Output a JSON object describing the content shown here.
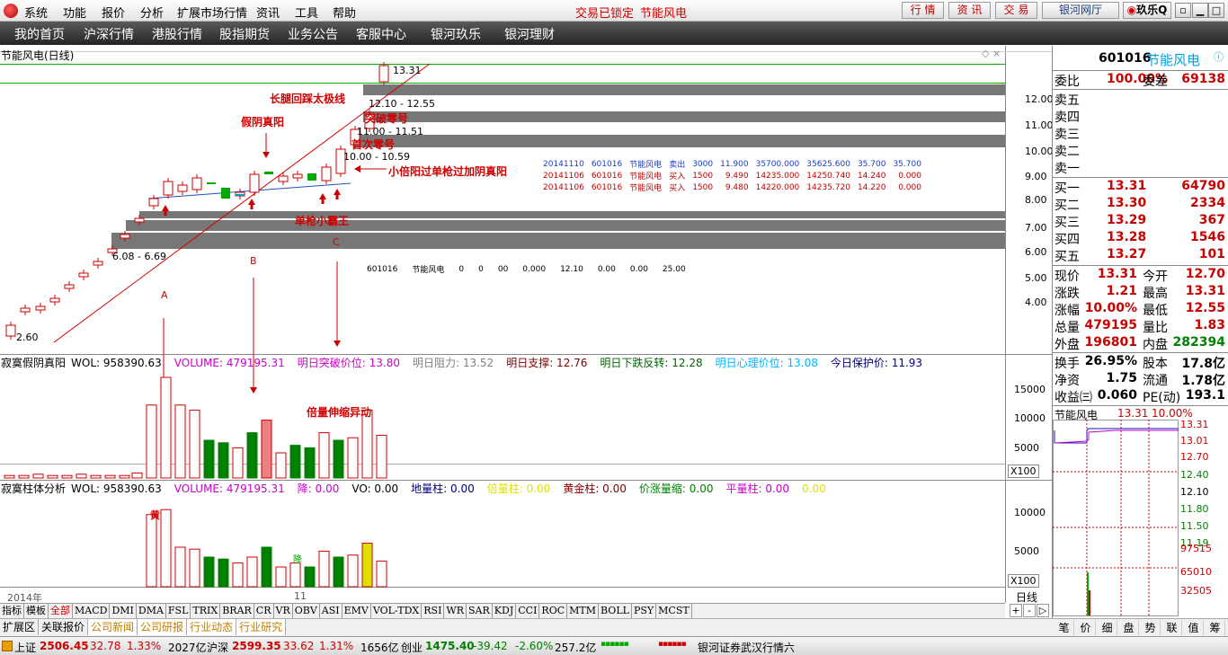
{
  "menu": {
    "items": [
      "系统",
      "功能",
      "报价",
      "分析",
      "扩展市场行情",
      "资讯",
      "工具",
      "帮助"
    ],
    "status_left": "交易已锁定",
    "status_stock": "节能风电",
    "btn_quote": "行 情",
    "btn_info": "资 讯",
    "btn_trade": "交 易",
    "btn_hall": "银河网厅",
    "btn_fun": "玖乐Q"
  },
  "nav": {
    "items": [
      "我的首页",
      "沪深行情",
      "港股行情",
      "股指期货",
      "业务公告",
      "客服中心",
      "银河玖乐",
      "银河理财"
    ]
  },
  "chart": {
    "title": "节能风电(日线)",
    "price_labels": {
      "high": "13.31",
      "low": "2.60",
      "r1": "12.10 - 12.55",
      "r2": "11.00 - 11.51",
      "r3": "10.00 - 10.59",
      "r4": "6.08 - 6.69"
    },
    "annotations": {
      "a1": "长腿回踩太极线",
      "a2": "假阴真阳",
      "a3": "突破零号",
      "a4": "首次零号",
      "a5": "小倍阳过单枪过加阴真阳",
      "a6": "单枪小霸王",
      "a7": "倍量伸缩异动",
      "lA": "A",
      "lB": "B",
      "lC": "C"
    },
    "yaxis": [
      "12.00",
      "11.00",
      "10.00",
      "9.00",
      "8.00",
      "7.00",
      "6.00",
      "5.00",
      "4.00"
    ],
    "deals": [
      [
        "20141110",
        "601016",
        "节能风电",
        "卖出",
        "3000",
        "11.900",
        "35700.000",
        "35625.600",
        "35.700",
        "35.700"
      ],
      [
        "20141106",
        "601016",
        "节能风电",
        "买入",
        "1500",
        "9.490",
        "14235.000",
        "14250.740",
        "14.240",
        "0.000"
      ],
      [
        "20141106",
        "601016",
        "节能风电",
        "买入",
        "1500",
        "9.480",
        "14220.000",
        "14235.720",
        "14.220",
        "0.000"
      ]
    ],
    "pos_row": [
      "601016",
      "节能风电",
      "0",
      "0",
      "00",
      "0.000",
      "12.10",
      "0.00",
      "0.00",
      "25.00"
    ]
  },
  "vol": {
    "name": "寂寞假阴真阳",
    "items": [
      {
        "t": "WOL: 958390.63",
        "c": "#000"
      },
      {
        "t": "VOLUME: 479195.31",
        "c": "#c800c8"
      },
      {
        "t": "明日突破价位: 13.80",
        "c": "#c800c8"
      },
      {
        "t": "明日阻力: 13.52",
        "c": "#808080"
      },
      {
        "t": "明日支撑: 12.76",
        "c": "#800000"
      },
      {
        "t": "明日下跌反转: 12.28",
        "c": "#006400"
      },
      {
        "t": "明日心理价位: 13.08",
        "c": "#00b4ff"
      },
      {
        "t": "今日保护价: 11.93",
        "c": "#000080"
      }
    ],
    "yaxis": [
      "15000",
      "10000",
      "5000"
    ],
    "unit": "X100"
  },
  "ind": {
    "name": "寂寞柱体分析",
    "items": [
      {
        "t": "WOL: 958390.63",
        "c": "#000"
      },
      {
        "t": "VOLUME: 479195.31",
        "c": "#c800c8"
      },
      {
        "t": "降: 0.00",
        "c": "#c800c8"
      },
      {
        "t": "VO: 0.00",
        "c": "#000"
      },
      {
        "t": "地量柱: 0.00",
        "c": "#000080"
      },
      {
        "t": "倍量柱: 0.00",
        "c": "#e0e000"
      },
      {
        "t": "黄金柱: 0.00",
        "c": "#800000"
      },
      {
        "t": "价涨量缩: 0.00",
        "c": "#008000"
      },
      {
        "t": "平量柱: 0.00",
        "c": "#c800c8"
      },
      {
        "t": "0.00",
        "c": "#e0e000"
      }
    ],
    "yaxis": [
      "10000",
      "5000"
    ],
    "unit": "X100",
    "year": "2014年",
    "month": "11",
    "label_huang": "黄",
    "label_jiang": "降"
  },
  "tabs": [
    "指标",
    "模板",
    "全部",
    "MACD",
    "DMI",
    "DMA",
    "FSL",
    "TRIX",
    "BRAR",
    "CR",
    "VR",
    "OBV",
    "ASI",
    "EMV",
    "VOL-TDX",
    "RSI",
    "WR",
    "SAR",
    "KDJ",
    "CCI",
    "ROC",
    "MTM",
    "BOLL",
    "PSY",
    "MCST"
  ],
  "ftabs": [
    "扩展区",
    "关联报价",
    "公司新闻",
    "公司研报",
    "行业动态",
    "行业研究"
  ],
  "quote": {
    "code": "601016",
    "name": "节能风电",
    "wb_label": "委比",
    "wb": "100.00%",
    "wc_label": "委差",
    "wc": "69138",
    "sells": [
      "卖五",
      "卖四",
      "卖三",
      "卖二",
      "卖一"
    ],
    "buys": [
      [
        "买一",
        "13.31",
        "64790"
      ],
      [
        "买二",
        "13.30",
        "2334"
      ],
      [
        "买三",
        "13.29",
        "367"
      ],
      [
        "买四",
        "13.28",
        "1546"
      ],
      [
        "买五",
        "13.27",
        "101"
      ]
    ],
    "stats": [
      [
        "现价",
        "13.31",
        "今开",
        "12.70"
      ],
      [
        "涨跌",
        "1.21",
        "最高",
        "13.31"
      ],
      [
        "涨幅",
        "10.00%",
        "最低",
        "12.55"
      ],
      [
        "总量",
        "479195",
        "量比",
        "1.83"
      ],
      [
        "外盘",
        "196801",
        "内盘",
        "282394"
      ]
    ],
    "stats2": [
      [
        "换手",
        "26.95%",
        "股本",
        "17.8亿"
      ],
      [
        "净资",
        "1.75",
        "流通",
        "1.78亿"
      ],
      [
        "收益㈢",
        "0.060",
        "PE(动)",
        "193.1"
      ]
    ],
    "mini_name": "节能风电",
    "mini_price": "13.31",
    "mini_pct": "10.00%",
    "mini_y": [
      "13.31",
      "13.01",
      "12.70",
      "12.40",
      "12.10",
      "11.80",
      "11.50",
      "11.19"
    ],
    "mini_v": [
      "97515",
      "65010",
      "32505"
    ],
    "mini_unit": "日线",
    "tabs": [
      "笔",
      "价",
      "细",
      "盘",
      "势",
      "联",
      "值",
      "筹"
    ]
  },
  "status": {
    "sh": "上证",
    "sh_v": "2506.45",
    "sh_c": "32.78",
    "sh_p": "1.33%",
    "sh_a": "2027亿",
    "hs": "沪深",
    "hs_v": "2599.35",
    "hs_c": "33.62",
    "hs_p": "1.31%",
    "hs_a": "1656亿",
    "cy": "创业",
    "cy_v": "1475.40",
    "cy_c": "-39.42",
    "cy_p": "-2.60%",
    "cy_a": "257.2亿",
    "broker": "银河证券武汉行情六"
  }
}
